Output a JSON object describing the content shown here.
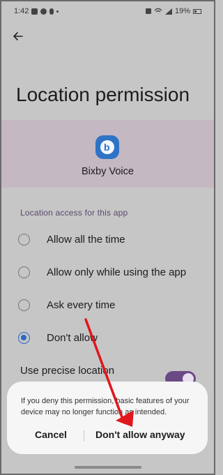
{
  "status_bar": {
    "time": "1:42",
    "battery": "19%"
  },
  "header": {
    "title": "Location permission"
  },
  "app": {
    "name": "Bixby Voice",
    "icon": "bixby-icon"
  },
  "location_access": {
    "section_title": "Location access for this app",
    "options": [
      {
        "label": "Allow all the time",
        "selected": false
      },
      {
        "label": "Allow only while using the app",
        "selected": false
      },
      {
        "label": "Ask every time",
        "selected": false
      },
      {
        "label": "Don't allow",
        "selected": true
      }
    ]
  },
  "precise_location": {
    "label": "Use precise location",
    "enabled": true
  },
  "dialog": {
    "message": "If you deny this permission, basic features of your device may no longer function as intended.",
    "cancel_label": "Cancel",
    "confirm_label": "Don't allow anyway"
  },
  "colors": {
    "accent": "#2f66c4",
    "toggle": "#6a4a84",
    "annotation_arrow": "#e0161b",
    "app_band": "#c4b8c2"
  }
}
